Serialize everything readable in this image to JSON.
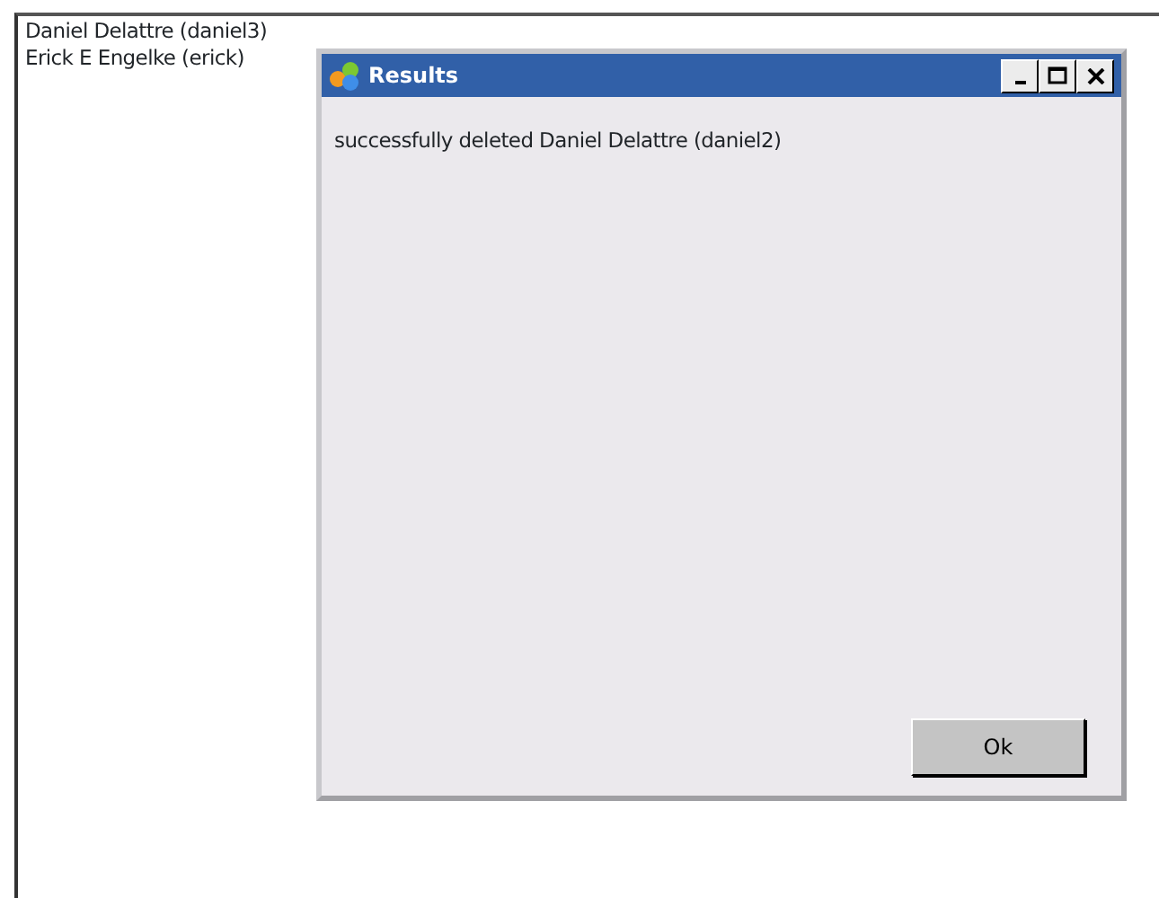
{
  "list": {
    "items": [
      "Daniel Delattre (daniel3)",
      "Erick E Engelke (erick)"
    ]
  },
  "dialog": {
    "title": "Results",
    "message": "successfully deleted Daniel Delattre (daniel2)",
    "buttons": [
      "Ok"
    ]
  }
}
